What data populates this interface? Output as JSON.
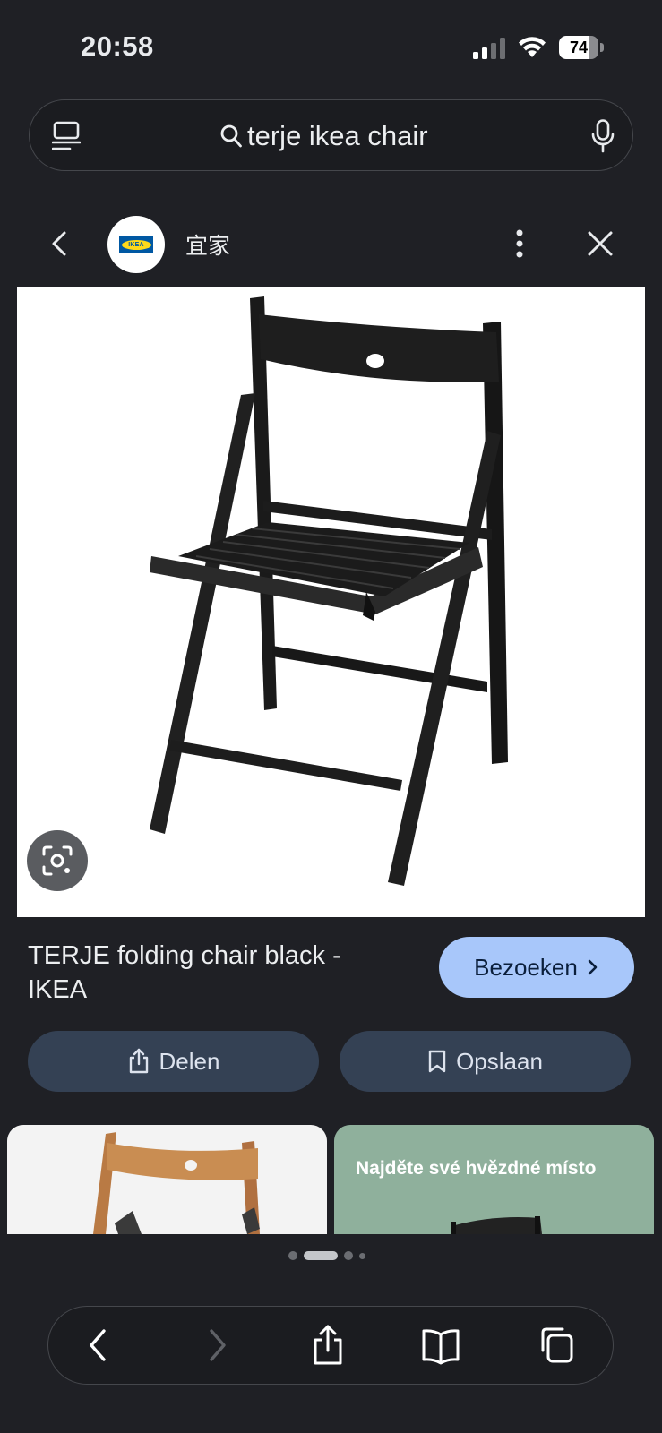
{
  "status_bar": {
    "time": "20:58",
    "battery_percent": "74",
    "battery_level": 0.74,
    "icons": [
      "signal-icon",
      "wifi-icon",
      "battery-icon"
    ]
  },
  "search": {
    "query": "terje ikea chair",
    "icons": [
      "lens-menu-icon",
      "search-icon",
      "mic-icon"
    ]
  },
  "header": {
    "site_name": "宜家",
    "logo_text": "IKEA",
    "icons": [
      "back-icon",
      "more-icon",
      "close-icon"
    ]
  },
  "result": {
    "title": "TERJE folding chair black - IKEA",
    "visit_label": "Bezoeken",
    "share_label": "Delen",
    "save_label": "Opslaan"
  },
  "related": {
    "thumb2_text": "Najděte své hvězdné místo"
  },
  "pagination": {
    "count": 5,
    "active": 1
  },
  "toolbar": {
    "icons": [
      "back-icon",
      "forward-icon",
      "share-icon",
      "bookmarks-icon",
      "tabs-icon"
    ]
  },
  "colors": {
    "background": "#1f2025",
    "visit_button": "#a8c7fa",
    "pill_button": "#344154",
    "ikea_blue": "#0058a3",
    "ikea_yellow": "#ffda1a"
  }
}
